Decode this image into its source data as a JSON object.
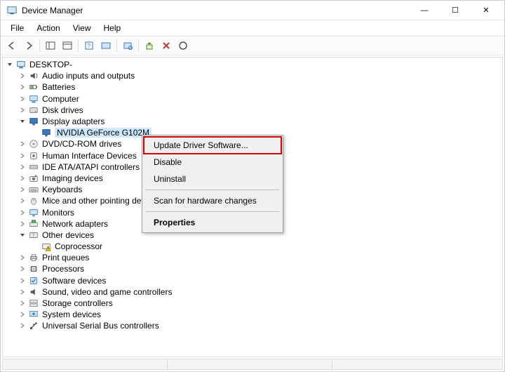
{
  "title": "Device Manager",
  "window_controls": {
    "min": "—",
    "max": "☐",
    "close": "✕"
  },
  "menus": [
    "File",
    "Action",
    "View",
    "Help"
  ],
  "tree": {
    "root": "DESKTOP-",
    "nodes": [
      {
        "label": "Audio inputs and outputs",
        "twisty": ">",
        "icon": "audio"
      },
      {
        "label": "Batteries",
        "twisty": ">",
        "icon": "battery"
      },
      {
        "label": "Computer",
        "twisty": ">",
        "icon": "computer"
      },
      {
        "label": "Disk drives",
        "twisty": ">",
        "icon": "disk"
      },
      {
        "label": "Display adapters",
        "twisty": "v",
        "icon": "display",
        "expanded": true,
        "children": [
          {
            "label": "NVIDIA GeForce G102M",
            "icon": "display",
            "selected": true
          }
        ]
      },
      {
        "label": "DVD/CD-ROM drives",
        "twisty": ">",
        "icon": "cdrom"
      },
      {
        "label": "Human Interface Devices",
        "twisty": ">",
        "icon": "hid"
      },
      {
        "label": "IDE ATA/ATAPI controllers",
        "twisty": ">",
        "icon": "ide"
      },
      {
        "label": "Imaging devices",
        "twisty": ">",
        "icon": "imaging"
      },
      {
        "label": "Keyboards",
        "twisty": ">",
        "icon": "keyboard"
      },
      {
        "label": "Mice and other pointing devices",
        "twisty": ">",
        "icon": "mouse"
      },
      {
        "label": "Monitors",
        "twisty": ">",
        "icon": "monitor"
      },
      {
        "label": "Network adapters",
        "twisty": ">",
        "icon": "network"
      },
      {
        "label": "Other devices",
        "twisty": "v",
        "icon": "other",
        "expanded": true,
        "children": [
          {
            "label": "Coprocessor",
            "icon": "warn"
          }
        ]
      },
      {
        "label": "Print queues",
        "twisty": ">",
        "icon": "printer"
      },
      {
        "label": "Processors",
        "twisty": ">",
        "icon": "cpu"
      },
      {
        "label": "Software devices",
        "twisty": ">",
        "icon": "software"
      },
      {
        "label": "Sound, video and game controllers",
        "twisty": ">",
        "icon": "sound"
      },
      {
        "label": "Storage controllers",
        "twisty": ">",
        "icon": "storage"
      },
      {
        "label": "System devices",
        "twisty": ">",
        "icon": "system"
      },
      {
        "label": "Universal Serial Bus controllers",
        "twisty": ">",
        "icon": "usb"
      }
    ]
  },
  "context_menu": {
    "items": [
      {
        "label": "Update Driver Software...",
        "highlight": true
      },
      {
        "label": "Disable"
      },
      {
        "label": "Uninstall"
      },
      {
        "sep": true
      },
      {
        "label": "Scan for hardware changes"
      },
      {
        "sep": true
      },
      {
        "label": "Properties",
        "bold": true
      }
    ]
  }
}
